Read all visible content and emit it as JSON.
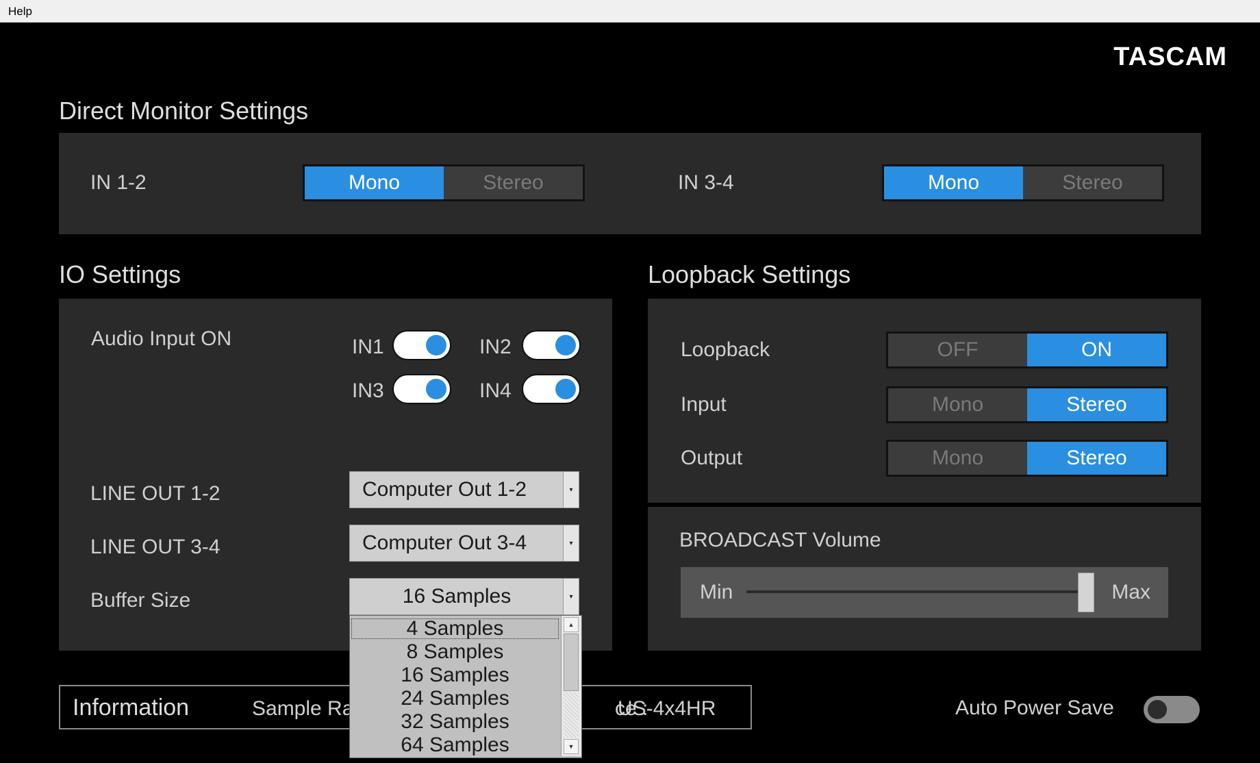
{
  "menu": {
    "help": "Help"
  },
  "brand": {
    "logo": "TASCAM"
  },
  "direct_monitor": {
    "title": "Direct Monitor Settings",
    "in12": {
      "label": "IN 1-2",
      "options": [
        "Mono",
        "Stereo"
      ],
      "selected": "Mono"
    },
    "in34": {
      "label": "IN 3-4",
      "options": [
        "Mono",
        "Stereo"
      ],
      "selected": "Mono"
    }
  },
  "io": {
    "title": "IO Settings",
    "audio_input_label": "Audio Input ON",
    "inputs": [
      {
        "label": "IN1",
        "on": true
      },
      {
        "label": "IN2",
        "on": true
      },
      {
        "label": "IN3",
        "on": true
      },
      {
        "label": "IN4",
        "on": true
      }
    ],
    "line_out_12": {
      "label": "LINE OUT 1-2",
      "value": "Computer Out 1-2"
    },
    "line_out_34": {
      "label": "LINE OUT 3-4",
      "value": "Computer Out 3-4"
    },
    "buffer": {
      "label": "Buffer Size",
      "value": "16 Samples",
      "options": [
        "4 Samples",
        "8 Samples",
        "16 Samples",
        "24 Samples",
        "32 Samples",
        "64 Samples"
      ],
      "highlighted": "4 Samples"
    }
  },
  "loopback": {
    "title": "Loopback Settings",
    "loopback": {
      "label": "Loopback",
      "options": [
        "OFF",
        "ON"
      ],
      "selected": "ON"
    },
    "input": {
      "label": "Input",
      "options": [
        "Mono",
        "Stereo"
      ],
      "selected": "Stereo"
    },
    "output": {
      "label": "Output",
      "options": [
        "Mono",
        "Stereo"
      ],
      "selected": "Stereo"
    }
  },
  "broadcast": {
    "title": "BROADCAST Volume",
    "min_label": "Min",
    "max_label": "Max",
    "value_fraction": 1.0
  },
  "info": {
    "title": "Information",
    "sample_rate_partial": "Sample Ra",
    "device_partial": "ce :",
    "device_value": "US-4x4HR"
  },
  "auto_power_save": {
    "label": "Auto Power Save",
    "on": false
  },
  "colors": {
    "accent": "#2a8fe0",
    "panel": "#2a2a2a",
    "background": "#000000"
  }
}
